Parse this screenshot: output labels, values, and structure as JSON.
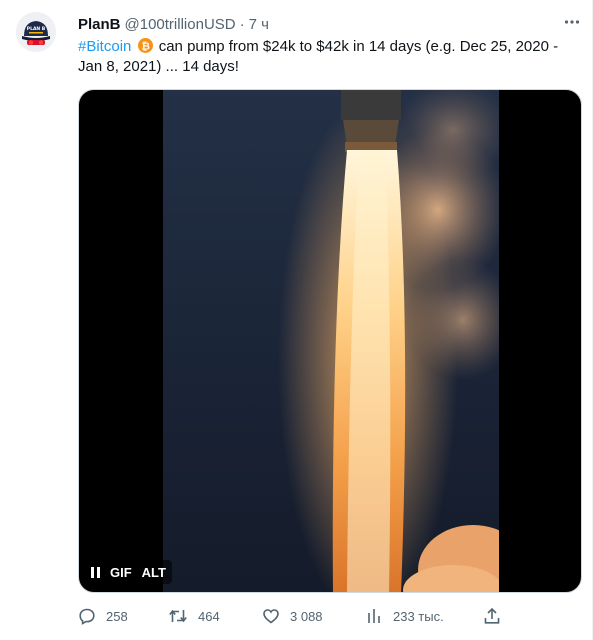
{
  "tweet": {
    "author_name": "PlanB",
    "handle": "@100trillionUSD",
    "separator": "·",
    "time": "7 ч",
    "text_hashtag": "#Bitcoin",
    "text_body": " can pump from $24k to $42k in 14 days (e.g. Dec 25, 2020 - Jan 8, 2021) ... 14 days!",
    "avatar_text": "PLAN B"
  },
  "media": {
    "type": "GIF",
    "gif_label": "GIF",
    "alt_label": "ALT"
  },
  "actions": {
    "replies": "258",
    "retweets": "464",
    "likes": "3 088",
    "views": "233 тыс."
  },
  "colors": {
    "link": "#1d9bf0",
    "secondary_text": "#536471",
    "primary_text": "#0f1419"
  },
  "icons": {
    "reply": "reply-icon",
    "retweet": "retweet-icon",
    "like": "heart-icon",
    "views": "views-icon",
    "share": "share-icon",
    "more": "more-icon",
    "bitcoin": "bitcoin-icon",
    "pause": "pause-icon"
  }
}
